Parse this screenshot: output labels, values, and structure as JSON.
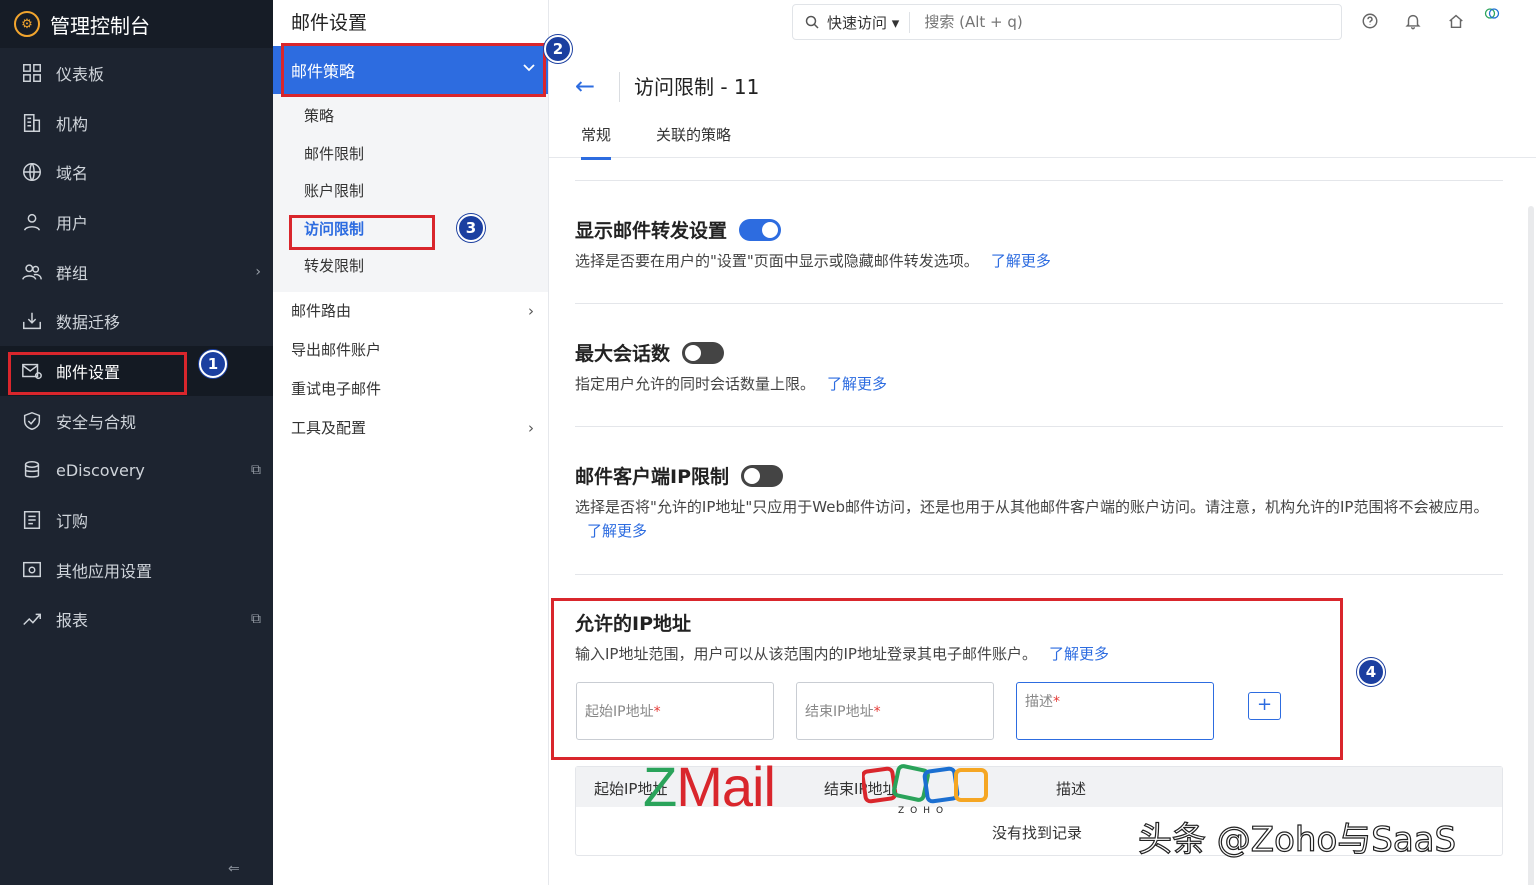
{
  "sidebar": {
    "title": "管理控制台",
    "items": [
      {
        "label": "仪表板",
        "icon": "dashboard-icon"
      },
      {
        "label": "机构",
        "icon": "building-icon"
      },
      {
        "label": "域名",
        "icon": "globe-icon"
      },
      {
        "label": "用户",
        "icon": "user-icon"
      },
      {
        "label": "群组",
        "icon": "group-icon"
      },
      {
        "label": "数据迁移",
        "icon": "migrate-icon"
      },
      {
        "label": "邮件设置",
        "icon": "mail-settings-icon"
      },
      {
        "label": "安全与合规",
        "icon": "shield-icon"
      },
      {
        "label": "eDiscovery",
        "icon": "ediscovery-icon"
      },
      {
        "label": "订购",
        "icon": "subscription-icon"
      },
      {
        "label": "其他应用设置",
        "icon": "apps-settings-icon"
      },
      {
        "label": "报表",
        "icon": "report-icon"
      }
    ],
    "collapse_glyph": "⇐"
  },
  "submenu": {
    "header": "邮件设置",
    "group": "邮件策略",
    "sub_items": [
      "策略",
      "邮件限制",
      "账户限制",
      "访问限制",
      "转发限制"
    ],
    "items": [
      "邮件路由",
      "导出邮件账户",
      "重试电子邮件",
      "工具及配置"
    ]
  },
  "topbar": {
    "quick_access": "快速访问",
    "search_placeholder": "搜索 (Alt + q)"
  },
  "page": {
    "title": "访问限制 - 11",
    "tabs": [
      "常规",
      "关联的策略"
    ],
    "sections": {
      "forward": {
        "title": "显示邮件转发设置",
        "desc": "选择是否要在用户的\"设置\"页面中显示或隐藏邮件转发选项。",
        "link": "了解更多",
        "enabled": true
      },
      "sessions": {
        "title": "最大会话数",
        "desc": "指定用户允许的同时会话数量上限。",
        "link": "了解更多",
        "enabled": false
      },
      "client_ip": {
        "title": "邮件客户端IP限制",
        "desc": "选择是否将\"允许的IP地址\"只应用于Web邮件访问，还是也用于从其他邮件客户端的账户访问。请注意，机构允许的IP范围将不会被应用。",
        "link": "了解更多",
        "enabled": false
      },
      "allowed_ip": {
        "title": "允许的IP地址",
        "desc": "输入IP地址范围，用户可以从该范围内的IP地址登录其电子邮件账户。",
        "link": "了解更多"
      }
    },
    "fields": {
      "start_ip": "起始IP地址",
      "end_ip": "结束IP地址",
      "description": "描述",
      "required_mark": "*",
      "add": "+"
    },
    "table": {
      "headers": [
        "起始IP地址",
        "结束IP地址",
        "描述"
      ],
      "empty": "没有找到记录"
    }
  },
  "annotations": [
    "1",
    "2",
    "3",
    "4"
  ],
  "overlay": {
    "zmail": "Mail",
    "zmail_z": "Z",
    "zoho": "ZOHO",
    "watermark": "头条 @Zoho与SaaS"
  }
}
